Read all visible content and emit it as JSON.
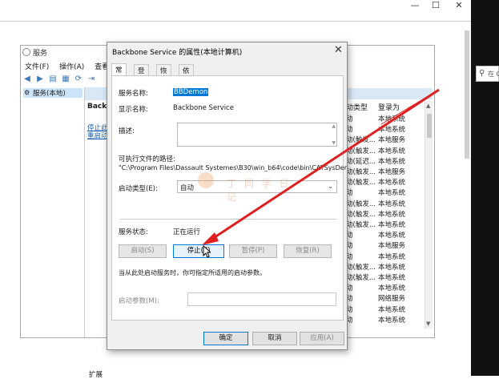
{
  "desktop": {
    "minimize": "—",
    "maximize": "☐",
    "close": "✕",
    "search_placeholder": "在 C"
  },
  "services_window": {
    "title": "服务",
    "menu": [
      "文件(F)",
      "操作(A)",
      "查看(V)"
    ],
    "toolbar_icons": [
      "back-arrow-icon",
      "forward-arrow-icon",
      "list-icon",
      "properties-icon",
      "refresh-icon",
      "export-icon"
    ],
    "tree_item": "服务(本地)",
    "selected_service_name": "Backb",
    "action_stop": "停止此",
    "action_restart": "重启动",
    "bottom_tab": "扩展",
    "columns": {
      "startup_type": "动类型",
      "logon_as": "登录为"
    },
    "rows": [
      {
        "type": "动",
        "logon": "本地系统"
      },
      {
        "type": "动",
        "logon": "本地系统"
      },
      {
        "type": "动(触发...",
        "logon": "本地服务"
      },
      {
        "type": "动(触发...",
        "logon": "本地系统"
      },
      {
        "type": "动(延迟...",
        "logon": "本地系统"
      },
      {
        "type": "动(触发...",
        "logon": "本地服务"
      },
      {
        "type": "动(触发...",
        "logon": "本地系统"
      },
      {
        "type": "动",
        "logon": "本地系统"
      },
      {
        "type": "动(触发...",
        "logon": "本地系统"
      },
      {
        "type": "动(触发...",
        "logon": "本地系统"
      },
      {
        "type": "动(触发...",
        "logon": "本地系统"
      },
      {
        "type": "动",
        "logon": "本地系统"
      },
      {
        "type": "动",
        "logon": "本地服务"
      },
      {
        "type": "动",
        "logon": "本地系统"
      },
      {
        "type": "动(触发...",
        "logon": "本地系统"
      },
      {
        "type": "动(触发...",
        "logon": "本地系统"
      },
      {
        "type": "动",
        "logon": "本地系统"
      },
      {
        "type": "动",
        "logon": "网络服务"
      },
      {
        "type": "动",
        "logon": "本地系统"
      },
      {
        "type": "动",
        "logon": "本地系统"
      }
    ]
  },
  "dialog": {
    "title": "Backbone Service 的属性(本地计算机)",
    "tabs": [
      "常规",
      "登录",
      "恢复",
      "依存关系"
    ],
    "service_name_label": "服务名称:",
    "service_name_value": "BBDemon",
    "display_name_label": "显示名称:",
    "display_name_value": "Backbone Service",
    "description_label": "描述:",
    "exe_path_label": "可执行文件的路径:",
    "exe_path_value": "\"C:\\Program Files\\Dassault Systemes\\B30\\win_b64\\code\\bin\\CATSysDer",
    "startup_type_label": "启动类型(E):",
    "startup_type_value": "自动",
    "service_status_label": "服务状态:",
    "service_status_value": "正在运行",
    "btn_start": "启动(S)",
    "btn_stop": "停止(T)",
    "btn_pause": "暂停(P)",
    "btn_resume": "恢复(R)",
    "hint": "当从此处启动服务时，你可指定所适用的启动参数。",
    "start_params_label": "启动参数(M):",
    "btn_ok": "确定",
    "btn_cancel": "取消",
    "btn_apply": "应用(A)"
  },
  "watermark": "丁 同 学 日 记"
}
